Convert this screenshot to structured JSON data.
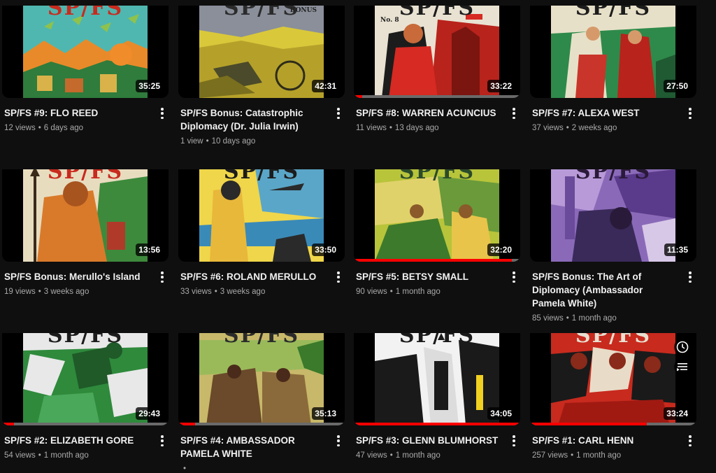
{
  "videos": [
    {
      "title": "SP/FS #9: FLO REED",
      "views": "12 views",
      "age": "6 days ago",
      "duration": "35:25",
      "progress": 0,
      "masthead": "SP/FS"
    },
    {
      "title": "SP/FS Bonus: Catastrophic Diplomacy (Dr. Julia Irwin)",
      "views": "1 view",
      "age": "10 days ago",
      "duration": "42:31",
      "progress": 0,
      "masthead": "SP/FS",
      "sub": "BONUS"
    },
    {
      "title": "SP/FS #8: WARREN ACUNCIUS",
      "views": "11 views",
      "age": "13 days ago",
      "duration": "33:22",
      "progress": 0.05,
      "masthead": "SP/FS",
      "sub": "No. 8"
    },
    {
      "title": "SP/FS #7: ALEXA WEST",
      "views": "37 views",
      "age": "2 weeks ago",
      "duration": "27:50",
      "progress": 0,
      "masthead": "SP/FS"
    },
    {
      "title": "SP/FS Bonus: Merullo's Island",
      "views": "19 views",
      "age": "3 weeks ago",
      "duration": "13:56",
      "progress": 0,
      "masthead": "SP/FS"
    },
    {
      "title": "SP/FS #6: ROLAND MERULLO",
      "views": "33 views",
      "age": "3 weeks ago",
      "duration": "33:50",
      "progress": 0,
      "masthead": "SP/FS"
    },
    {
      "title": "SP/FS #5: BETSY SMALL",
      "views": "90 views",
      "age": "1 month ago",
      "duration": "32:20",
      "progress": 0.95,
      "masthead": "SP/FS"
    },
    {
      "title": "SP/FS Bonus: The Art of Diplomacy (Ambassador Pamela White)",
      "views": "85 views",
      "age": "1 month ago",
      "duration": "11:35",
      "progress": 0,
      "masthead": "SP/FS"
    },
    {
      "title": "SP/FS #2: ELIZABETH GORE",
      "views": "54 views",
      "age": "1 month ago",
      "duration": "29:43",
      "progress": 0.07,
      "masthead": "SP/FS"
    },
    {
      "title": "SP/FS #4: AMBASSADOR PAMELA WHITE",
      "views": "",
      "age": "",
      "duration": "35:13",
      "progress": 0.1,
      "masthead": "SP/FS"
    },
    {
      "title": "SP/FS #3: GLENN BLUMHORST",
      "views": "47 views",
      "age": "1 month ago",
      "duration": "34:05",
      "progress": 1,
      "masthead": "SP/FS"
    },
    {
      "title": "SP/FS #1: CARL HENN",
      "views": "257 views",
      "age": "1 month ago",
      "duration": "33:24",
      "progress": 0.7,
      "masthead": "SP/FS"
    }
  ],
  "hover_icons": [
    "clock-icon",
    "add-to-queue-icon"
  ],
  "colors": {
    "background": "#0f0f0f",
    "accent": "#ff0000",
    "meta_text": "#aaaaaa"
  }
}
